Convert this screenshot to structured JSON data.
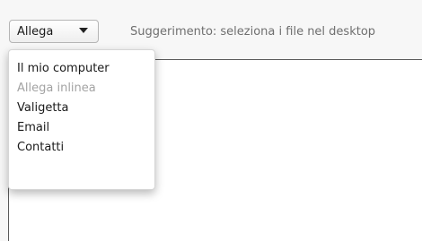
{
  "toolbar": {
    "attach_button": {
      "label": "Allega",
      "icon": "chevron-down-icon"
    },
    "hint": "Suggerimento: seleziona i file nel desktop"
  },
  "attach_menu": {
    "items": [
      {
        "label": "Il mio computer",
        "enabled": true
      },
      {
        "label": "Allega inlinea",
        "enabled": false
      },
      {
        "label": "Valigetta",
        "enabled": true
      },
      {
        "label": "Email",
        "enabled": true
      },
      {
        "label": "Contatti",
        "enabled": true
      }
    ]
  },
  "colors": {
    "hint_text": "#6f6f6f",
    "disabled_text": "#a3a3a3",
    "menu_background": "#ffffff"
  }
}
